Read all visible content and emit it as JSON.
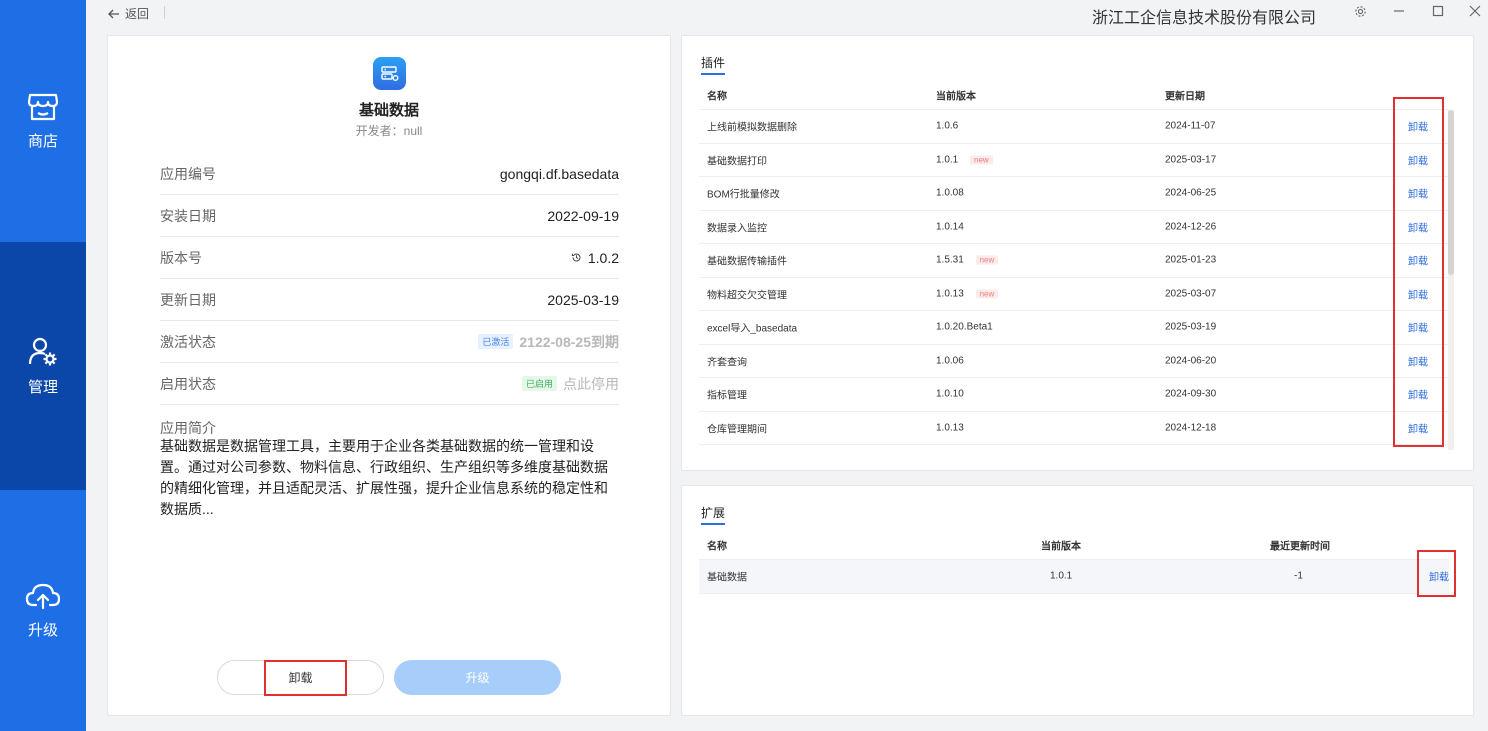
{
  "sidebar": {
    "items": [
      {
        "label": "商店",
        "icon": "store-icon"
      },
      {
        "label": "管理",
        "icon": "user-gear-icon",
        "active": true
      },
      {
        "label": "升级",
        "icon": "cloud-upload-icon"
      }
    ]
  },
  "topbar": {
    "back_label": "返回",
    "company": "浙江工企信息技术股份有限公司"
  },
  "app": {
    "name": "基础数据",
    "developer": "开发者：null",
    "rows": [
      {
        "key": "应用编号",
        "value": "gongqi.df.basedata"
      },
      {
        "key": "安装日期",
        "value": "2022-09-19"
      },
      {
        "key": "版本号",
        "value": "1.0.2"
      },
      {
        "key": "更新日期",
        "value": "2025-03-19"
      },
      {
        "key": "激活状态",
        "tag": "已激活",
        "value": "2122-08-25到期"
      },
      {
        "key": "启用状态",
        "tag": "已启用",
        "value": "点此停用"
      }
    ],
    "desc_label": "应用简介",
    "desc": "基础数据是数据管理工具，主要用于企业各类基础数据的统一管理和设置。通过对公司参数、物料信息、行政组织、生产组织等多维度基础数据的精细化管理，并且适配灵活、扩展性强，提升企业信息系统的稳定性和数据质...",
    "uninstall_label": "卸载",
    "upgrade_label": "升级"
  },
  "plugins": {
    "title": "插件",
    "headers": [
      "名称",
      "当前版本",
      "更新日期"
    ],
    "action": "卸载",
    "new_tag": "new",
    "rows": [
      {
        "name": "上线前模拟数据删除",
        "version": "1.0.6",
        "date": "2024-11-07",
        "new": false
      },
      {
        "name": "基础数据打印",
        "version": "1.0.1",
        "date": "2025-03-17",
        "new": true
      },
      {
        "name": "BOM行批量修改",
        "version": "1.0.08",
        "date": "2024-06-25",
        "new": false
      },
      {
        "name": "数据录入监控",
        "version": "1.0.14",
        "date": "2024-12-26",
        "new": false
      },
      {
        "name": "基础数据传输插件",
        "version": "1.5.31",
        "date": "2025-01-23",
        "new": true
      },
      {
        "name": "物料超交欠交管理",
        "version": "1.0.13",
        "date": "2025-03-07",
        "new": true
      },
      {
        "name": "excel导入_basedata",
        "version": "1.0.20.Beta1",
        "date": "2025-03-19",
        "new": false
      },
      {
        "name": "齐套查询",
        "version": "1.0.06",
        "date": "2024-06-20",
        "new": false
      },
      {
        "name": "指标管理",
        "version": "1.0.10",
        "date": "2024-09-30",
        "new": false
      },
      {
        "name": "仓库管理期间",
        "version": "1.0.13",
        "date": "2024-12-18",
        "new": false
      }
    ]
  },
  "extensions": {
    "title": "扩展",
    "headers": [
      "名称",
      "当前版本",
      "最近更新时间"
    ],
    "action": "卸载",
    "rows": [
      {
        "name": "基础数据",
        "version": "1.0.1",
        "date": "-1"
      }
    ]
  }
}
